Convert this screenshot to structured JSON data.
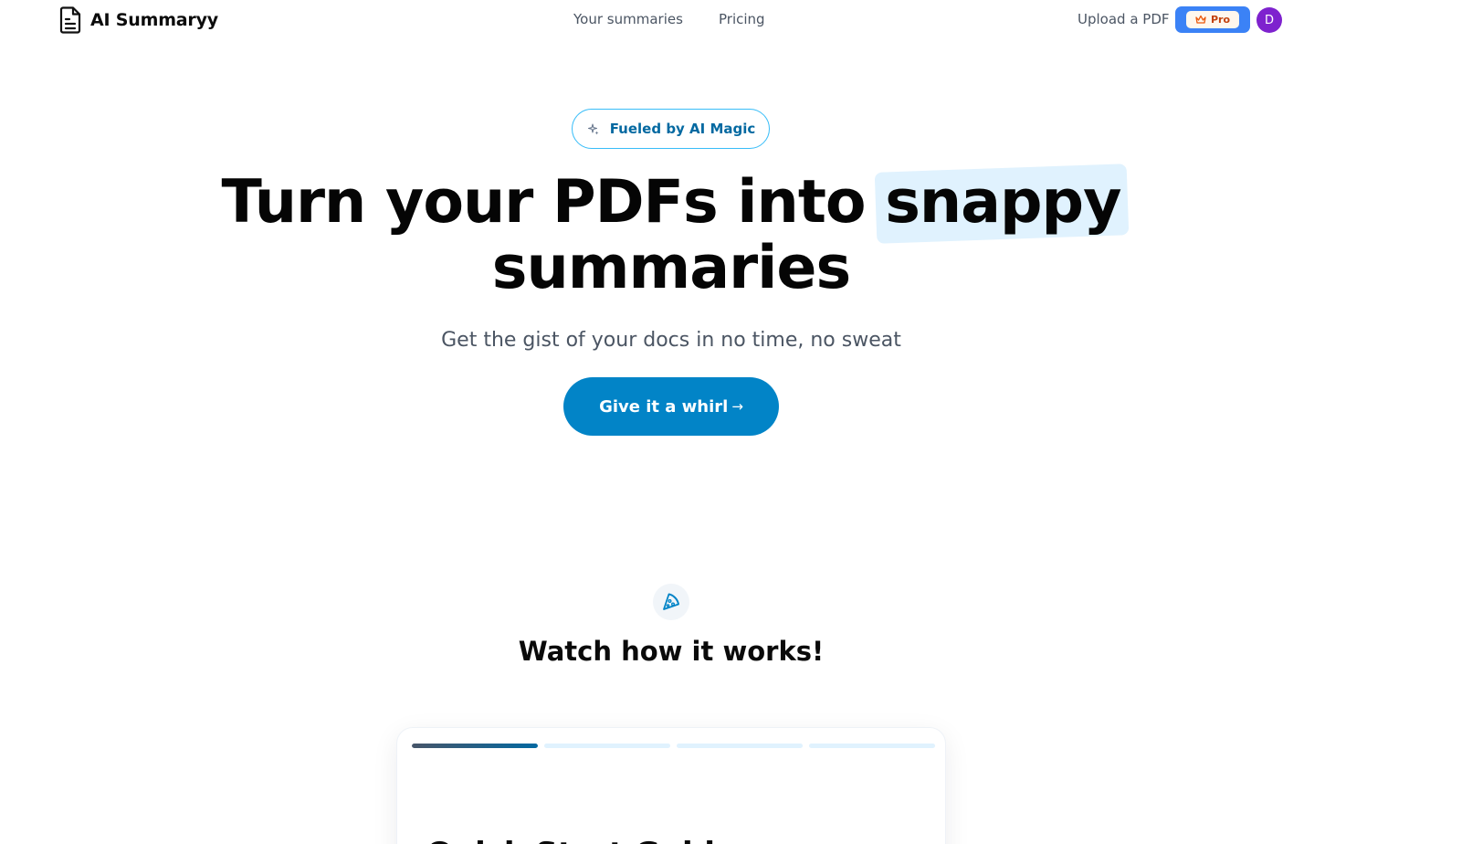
{
  "nav": {
    "brand": "AI Summaryy",
    "links": [
      "Your summaries",
      "Pricing"
    ],
    "upload_label": "Upload a PDF",
    "pro_label": "Pro",
    "avatar_initial": "D"
  },
  "hero": {
    "badge": "Fueled by AI Magic",
    "headline_before": "Turn your PDFs into",
    "headline_highlight": "snappy",
    "headline_line2": "summaries",
    "subheading": "Get the gist of your docs in no time, no sweat",
    "cta_label": "Give it a whirl",
    "cta_arrow": "→"
  },
  "how_it_works": {
    "title": "Watch how it works!",
    "progress": [
      1,
      0,
      0,
      0
    ],
    "card_title": "Quick Start Guide"
  },
  "colors": {
    "primary": "#0284c7",
    "pro_button": "#3b82f6",
    "avatar": "#7e22ce",
    "highlight": "#e0f2fe",
    "badge_border": "#38bdf8"
  },
  "icons": [
    "document-icon",
    "crown-icon",
    "sparkle-icon",
    "arrow-right-icon",
    "pizza-icon"
  ]
}
